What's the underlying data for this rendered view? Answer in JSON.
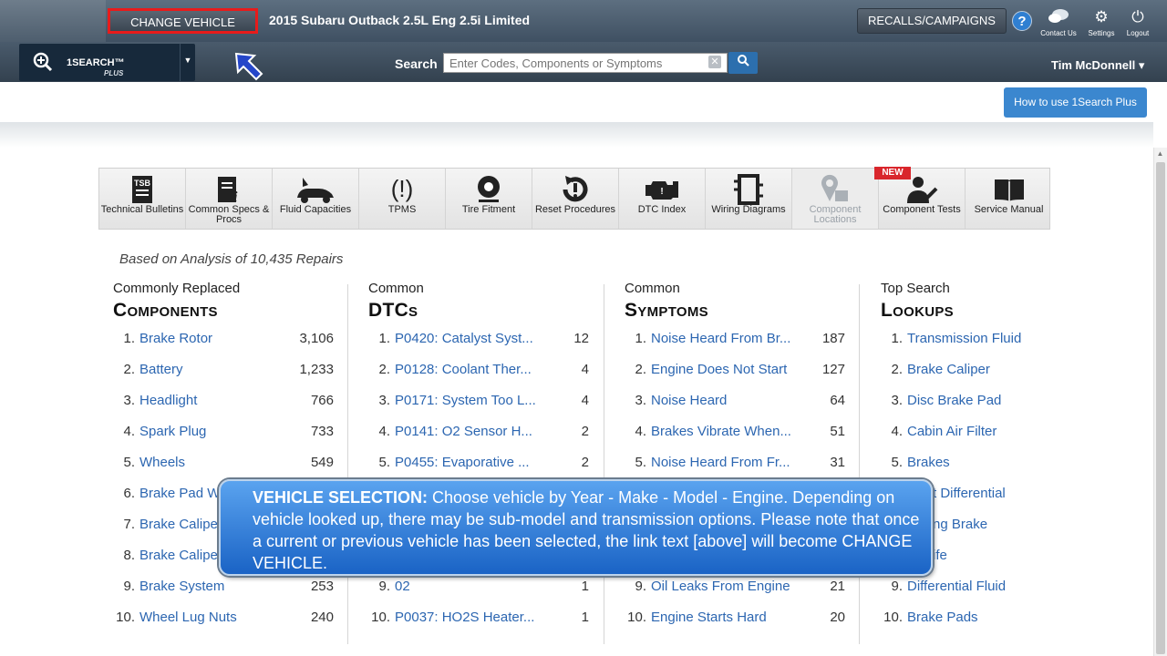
{
  "header": {
    "change_vehicle": "CHANGE VEHICLE",
    "vehicle_title": "2015 Subaru Outback 2.5L Eng 2.5i Limited",
    "recalls": "RECALLS/CAMPAIGNS",
    "help": "?",
    "contact_us": "Contact Us",
    "settings": "Settings",
    "logout": "Logout"
  },
  "subbar": {
    "onesearch_label": "1SEARCH™",
    "onesearch_plus": "PLUS",
    "search_label": "Search",
    "search_placeholder": "Enter Codes, Components or Symptoms",
    "user_name": "Tim McDonnell ▾"
  },
  "howto": "How to use 1Search Plus",
  "toolbar": [
    {
      "label": "Technical Bulletins",
      "icon": "tsb-icon"
    },
    {
      "label": "Common Specs & Procs",
      "icon": "specs-icon"
    },
    {
      "label": "Fluid Capacities",
      "icon": "fluid-icon"
    },
    {
      "label": "TPMS",
      "icon": "tpms-icon"
    },
    {
      "label": "Tire Fitment",
      "icon": "tire-icon"
    },
    {
      "label": "Reset Procedures",
      "icon": "reset-icon"
    },
    {
      "label": "DTC Index",
      "icon": "engine-icon"
    },
    {
      "label": "Wiring Diagrams",
      "icon": "wiring-icon"
    },
    {
      "label": "Component Locations",
      "icon": "location-icon"
    },
    {
      "label": "Component Tests",
      "icon": "tests-icon"
    },
    {
      "label": "Service Manual",
      "icon": "book-icon"
    }
  ],
  "new_badge": "NEW",
  "analysis": "Based on Analysis of 10,435 Repairs",
  "columns": [
    {
      "sub": "Commonly Replaced",
      "main": "Components",
      "items": [
        {
          "n": "1.",
          "name": "Brake Rotor",
          "count": "3,106"
        },
        {
          "n": "2.",
          "name": "Battery",
          "count": "1,233"
        },
        {
          "n": "3.",
          "name": "Headlight",
          "count": "766"
        },
        {
          "n": "4.",
          "name": "Spark Plug",
          "count": "733"
        },
        {
          "n": "5.",
          "name": "Wheels",
          "count": "549"
        },
        {
          "n": "6.",
          "name": "Brake Pad W",
          "count": ""
        },
        {
          "n": "7.",
          "name": "Brake Caliper",
          "count": ""
        },
        {
          "n": "8.",
          "name": "Brake Caliper",
          "count": ""
        },
        {
          "n": "9.",
          "name": "Brake System",
          "count": "253"
        },
        {
          "n": "10.",
          "name": "Wheel Lug Nuts",
          "count": "240"
        }
      ]
    },
    {
      "sub": "Common",
      "main": "DTCs",
      "items": [
        {
          "n": "1.",
          "name": "P0420: Catalyst Syst...",
          "count": "12"
        },
        {
          "n": "2.",
          "name": "P0128: Coolant Ther...",
          "count": "4"
        },
        {
          "n": "3.",
          "name": "P0171: System Too L...",
          "count": "4"
        },
        {
          "n": "4.",
          "name": "P0141: O2 Sensor H...",
          "count": "2"
        },
        {
          "n": "5.",
          "name": "P0455: Evaporative ...",
          "count": "2"
        },
        {
          "n": "",
          "name": "",
          "count": ""
        },
        {
          "n": "",
          "name": "",
          "count": ""
        },
        {
          "n": "",
          "name": "",
          "count": ""
        },
        {
          "n": "9.",
          "name": "02",
          "count": "1"
        },
        {
          "n": "10.",
          "name": "P0037: HO2S Heater...",
          "count": "1"
        }
      ]
    },
    {
      "sub": "Common",
      "main": "Symptoms",
      "items": [
        {
          "n": "1.",
          "name": "Noise Heard From Br...",
          "count": "187"
        },
        {
          "n": "2.",
          "name": "Engine Does Not Start",
          "count": "127"
        },
        {
          "n": "3.",
          "name": "Noise Heard",
          "count": "64"
        },
        {
          "n": "4.",
          "name": "Brakes Vibrate When...",
          "count": "51"
        },
        {
          "n": "5.",
          "name": "Noise Heard From Fr...",
          "count": "31"
        },
        {
          "n": "",
          "name": "",
          "count": ""
        },
        {
          "n": "",
          "name": "",
          "count": ""
        },
        {
          "n": "",
          "name": "",
          "count": ""
        },
        {
          "n": "9.",
          "name": "Oil Leaks From Engine",
          "count": "21"
        },
        {
          "n": "10.",
          "name": "Engine Starts Hard",
          "count": "20"
        }
      ]
    },
    {
      "sub": "Top Search",
      "main": "Lookups",
      "items": [
        {
          "n": "1.",
          "name": "Transmission Fluid",
          "count": ""
        },
        {
          "n": "2.",
          "name": "Brake Caliper",
          "count": ""
        },
        {
          "n": "3.",
          "name": "Disc Brake Pad",
          "count": ""
        },
        {
          "n": "4.",
          "name": "Cabin Air Filter",
          "count": ""
        },
        {
          "n": "5.",
          "name": "Brakes",
          "count": ""
        },
        {
          "n": "",
          "name": "t Differential",
          "count": ""
        },
        {
          "n": "",
          "name": "ng Brake",
          "count": ""
        },
        {
          "n": "",
          "name": "ife",
          "count": ""
        },
        {
          "n": "9.",
          "name": "Differential Fluid",
          "count": ""
        },
        {
          "n": "10.",
          "name": "Brake Pads",
          "count": ""
        }
      ]
    }
  ],
  "callout": {
    "heading": "VEHICLE SELECTION:",
    "text": " Choose vehicle by Year - Make - Model - Engine. Depending on vehicle looked up, there may be sub-model and transmission options. Please note that once a current or previous  vehicle has been selected, the link text [above] will become CHANGE VEHICLE."
  }
}
